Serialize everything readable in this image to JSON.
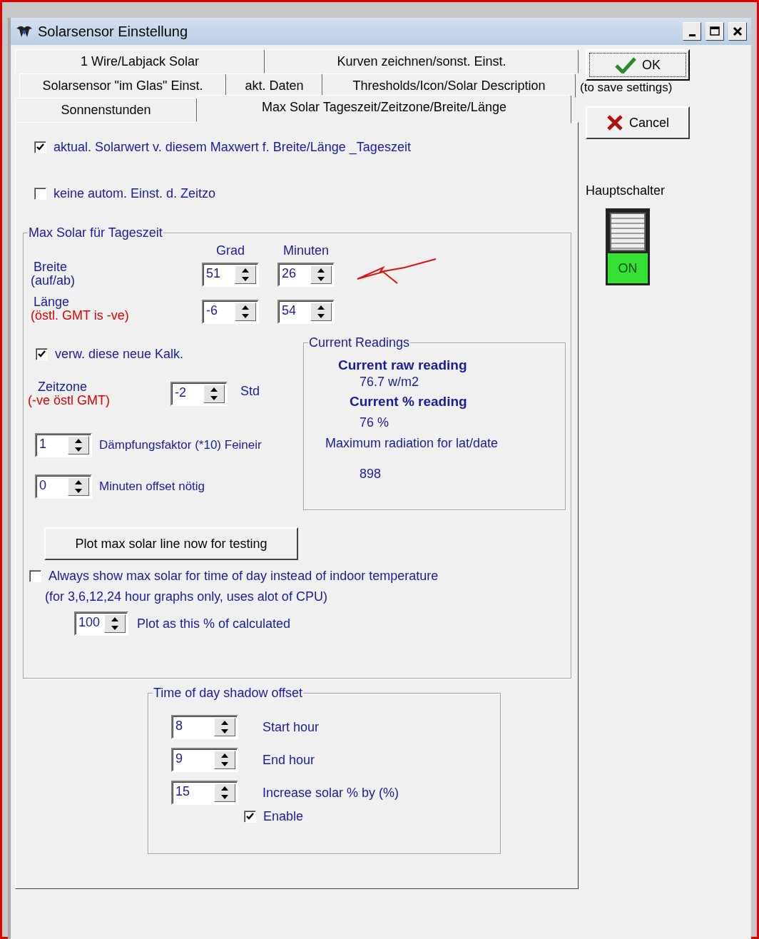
{
  "window": {
    "title": "Solarsensor Einstellung"
  },
  "tab_rows": [
    {
      "tabs": [
        {
          "label": "1 Wire/Labjack Solar",
          "selected": false
        },
        {
          "label": "Kurven zeichnen/sonst. Einst.",
          "selected": false
        }
      ]
    },
    {
      "tabs": [
        {
          "label": "Solarsensor \"im Glas\" Einst.",
          "selected": false
        },
        {
          "label": "akt. Daten",
          "selected": false
        },
        {
          "label": "Thresholds/Icon/Solar Description",
          "selected": false
        }
      ]
    },
    {
      "tabs": [
        {
          "label": "Sonnenstunden",
          "selected": false
        },
        {
          "label": "Max Solar Tageszeit/Zeitzone/Breite/Länge",
          "selected": true
        }
      ]
    }
  ],
  "options": [
    {
      "label": "aktual. Solarwert v. diesem Maxwert f. Breite/Länge _Tageszeit",
      "checked": true
    },
    {
      "label": "keine autom. Einst. d. Zeitzo",
      "checked": false
    }
  ],
  "max_solar_group": {
    "title": "Max Solar für Tageszeit",
    "column_headers": [
      "Grad",
      "Minuten"
    ],
    "rows": [
      {
        "label": "Breite",
        "note": "(auf/ab)",
        "kind": "normal",
        "values": [
          "51",
          "26"
        ]
      },
      {
        "label": "Länge",
        "note": "(östl. GMT is -ve)",
        "kind": "warning",
        "values": [
          "-6",
          "54"
        ]
      }
    ],
    "use_new_calc": {
      "label": "verw. diese neue Kalk.",
      "checked": true
    },
    "timezone": {
      "label": "Zeitzone",
      "note": "(-ve östl GMT)",
      "value": "-2",
      "unit": "Std"
    },
    "spins": [
      {
        "value": "1",
        "label": "Dämpfungsfaktor (*10) Feineir"
      },
      {
        "value": "0",
        "label": "Minuten offset nötig"
      }
    ],
    "current_readings": {
      "title": "Current Readings",
      "items": [
        {
          "kind": "heading",
          "text": "Current raw reading"
        },
        {
          "kind": "value",
          "text": "76.7 w/m2"
        },
        {
          "kind": "heading",
          "text": "Current % reading"
        },
        {
          "kind": "value",
          "text": "76 %"
        },
        {
          "kind": "label",
          "text": "Maximum radiation for lat/date"
        },
        {
          "kind": "value",
          "text": "898"
        }
      ]
    },
    "plot_button": "Plot max solar line now for testing",
    "always_show": {
      "label": "Always show max solar for time of day instead of indoor temperature",
      "note": "(for 3,6,12,24 hour graphs only, uses alot of CPU)",
      "checked": false
    },
    "plot_percent": {
      "value": "100",
      "label": "Plot as this % of calculated"
    }
  },
  "shadow_group": {
    "title": "Time of day shadow offset",
    "rows": [
      {
        "value": "8",
        "label": "Start hour"
      },
      {
        "value": "9",
        "label": "End hour"
      },
      {
        "value": "15",
        "label": "Increase solar % by (%)"
      }
    ],
    "enable": {
      "label": "Enable",
      "checked": true
    }
  },
  "ok_button": {
    "label": "OK",
    "note": "(to save settings)"
  },
  "cancel_button": {
    "label": "Cancel"
  },
  "main_switch": {
    "label": "Hauptschalter",
    "state_text": "ON",
    "on": true
  }
}
